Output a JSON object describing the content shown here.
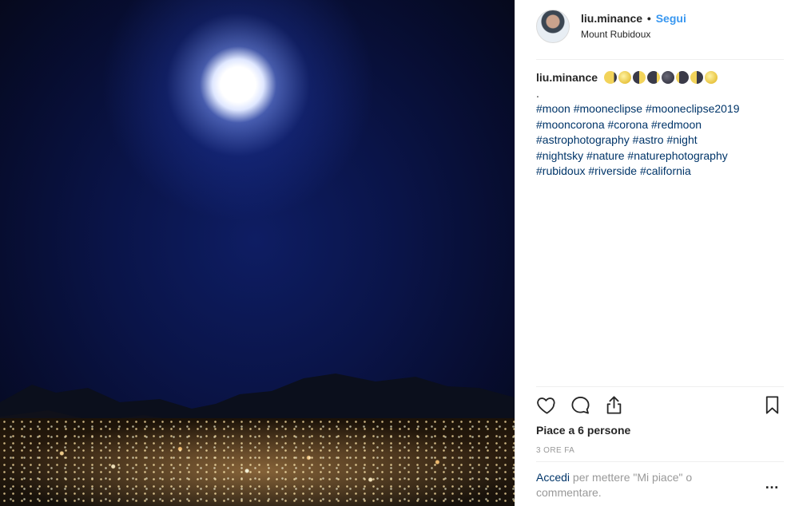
{
  "post": {
    "username": "liu.minance",
    "separator": "•",
    "follow_label": "Segui",
    "location": "Mount Rubidoux",
    "caption_dot": ".",
    "moons": [
      "waxing-gibbous-moon-icon",
      "full-moon-icon",
      "first-quarter-moon-icon",
      "waning-crescent-moon-icon",
      "new-moon-icon",
      "waxing-crescent-moon-icon",
      "last-quarter-moon-icon",
      "full-moon-icon"
    ],
    "hashtag_lines": [
      [
        "#moon",
        "#mooneclipse",
        "#mooneclipse2019"
      ],
      [
        "#mooncorona",
        "#corona",
        "#redmoon"
      ],
      [
        "#astrophotography",
        "#astro",
        "#night"
      ],
      [
        "#nightsky",
        "#nature",
        "#naturephotography"
      ],
      [
        "#rubidoux",
        "#riverside",
        "#california"
      ]
    ],
    "likes_text": "Piace a 6 persone",
    "time_text": "3 ORE FA",
    "login_link": "Accedi",
    "comment_prompt": " per mettere \"Mi piace\" o commentare.",
    "more_label": "…"
  },
  "icons": {
    "like": "heart-icon",
    "comment": "comment-icon",
    "share": "share-icon",
    "save": "bookmark-icon"
  },
  "colors": {
    "follow": "#3897f0",
    "hashtag": "#003569",
    "muted": "#999999"
  }
}
